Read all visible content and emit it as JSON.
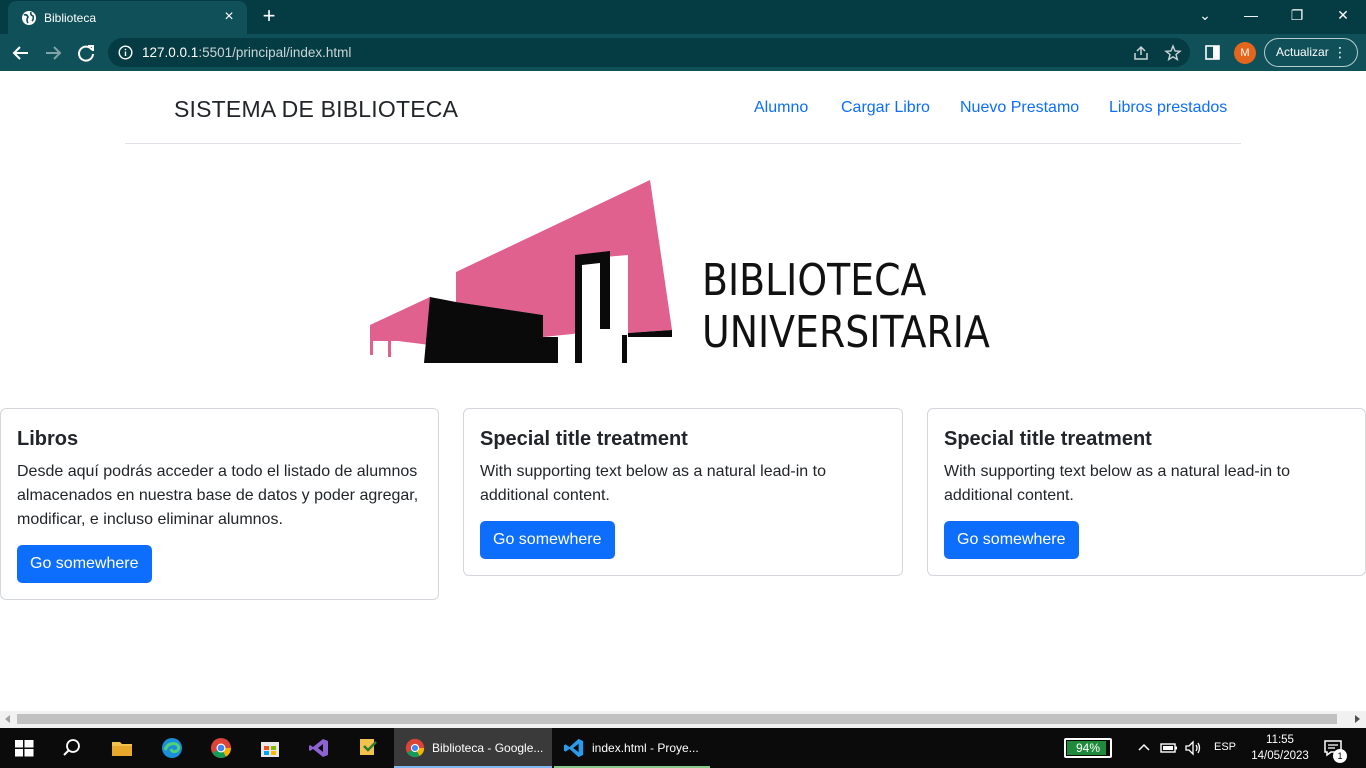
{
  "browser": {
    "tab_title": "Biblioteca",
    "tab_close_symbol": "×",
    "new_tab_symbol": "+",
    "url_host": "127.0.0.1",
    "url_path": ":5501/principal/index.html",
    "profile_initial": "M",
    "update_button_label": "Actualizar",
    "menu_symbol": "⋮",
    "window_controls": {
      "dropdown": "⌄",
      "minimize": "—",
      "restore": "❐",
      "close": "✕"
    }
  },
  "page": {
    "brand": "SISTEMA DE BIBLIOTECA",
    "nav": [
      "Alumno",
      "Cargar Libro",
      "Nuevo Prestamo",
      "Libros prestados"
    ],
    "logo": {
      "line1": "BIBLIOTECA",
      "line2": "UNIVERSITARIA",
      "pink": "#e0608e",
      "black": "#0a0a0a"
    },
    "cards": [
      {
        "title": "Libros",
        "text": "Desde aquí podrás acceder a todo el listado de alumnos almacenados en nuestra base de datos y poder agregar, modificar, e incluso eliminar alumnos.",
        "button": "Go somewhere"
      },
      {
        "title": "Special title treatment",
        "text": "With supporting text below as a natural lead-in to additional content.",
        "button": "Go somewhere"
      },
      {
        "title": "Special title treatment",
        "text": "With supporting text below as a natural lead-in to additional content.",
        "button": "Go somewhere"
      }
    ],
    "accent_color": "#0d6efd"
  },
  "taskbar": {
    "apps": [
      {
        "label": "Biblioteca - Google...",
        "icon": "chrome-icon"
      },
      {
        "label": "index.html - Proye...",
        "icon": "vscode-icon"
      }
    ],
    "battery": "94%",
    "battery_level": 0.94,
    "language": "ESP",
    "time": "11:55",
    "date": "14/05/2023",
    "notifications": "1"
  }
}
